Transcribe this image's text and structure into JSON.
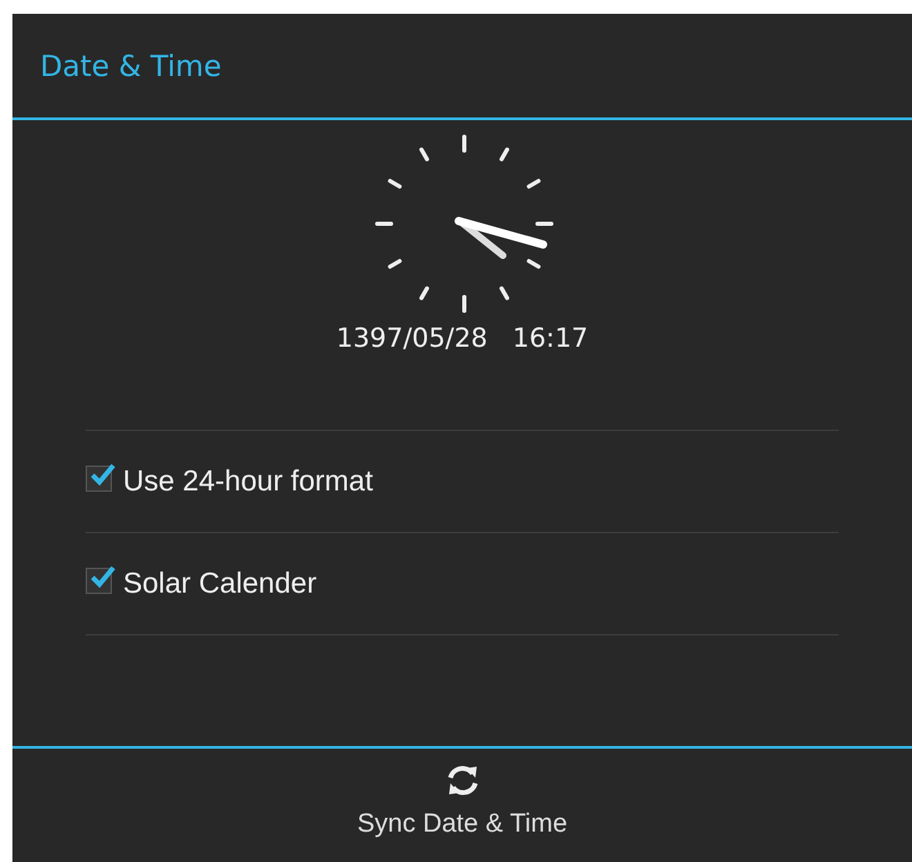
{
  "dialog": {
    "title": "Date & Time"
  },
  "datetime": {
    "date": "1397/05/28",
    "time": "16:17"
  },
  "options": [
    {
      "label": "Use 24-hour format",
      "checked": true
    },
    {
      "label": "Solar Calender",
      "checked": true
    }
  ],
  "action": {
    "label": "Sync Date & Time"
  }
}
